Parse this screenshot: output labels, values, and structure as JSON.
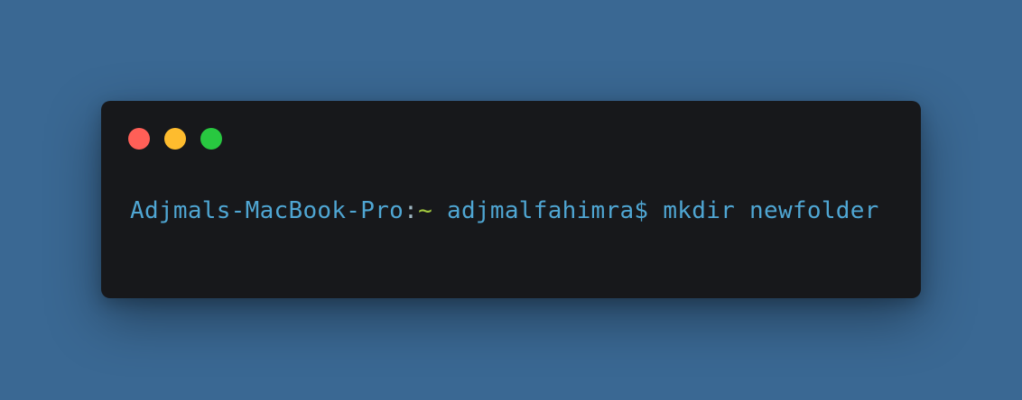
{
  "window": {
    "controls": [
      {
        "name": "close",
        "color": "#ff5f57"
      },
      {
        "name": "minimize",
        "color": "#febc2e"
      },
      {
        "name": "zoom",
        "color": "#28c840"
      }
    ]
  },
  "terminal": {
    "host": "Adjmals-MacBook-Pro",
    "separator": ":",
    "path": "~",
    "user_prompt": " adjmalfahimra$",
    "command": " mkdir newfolder"
  }
}
